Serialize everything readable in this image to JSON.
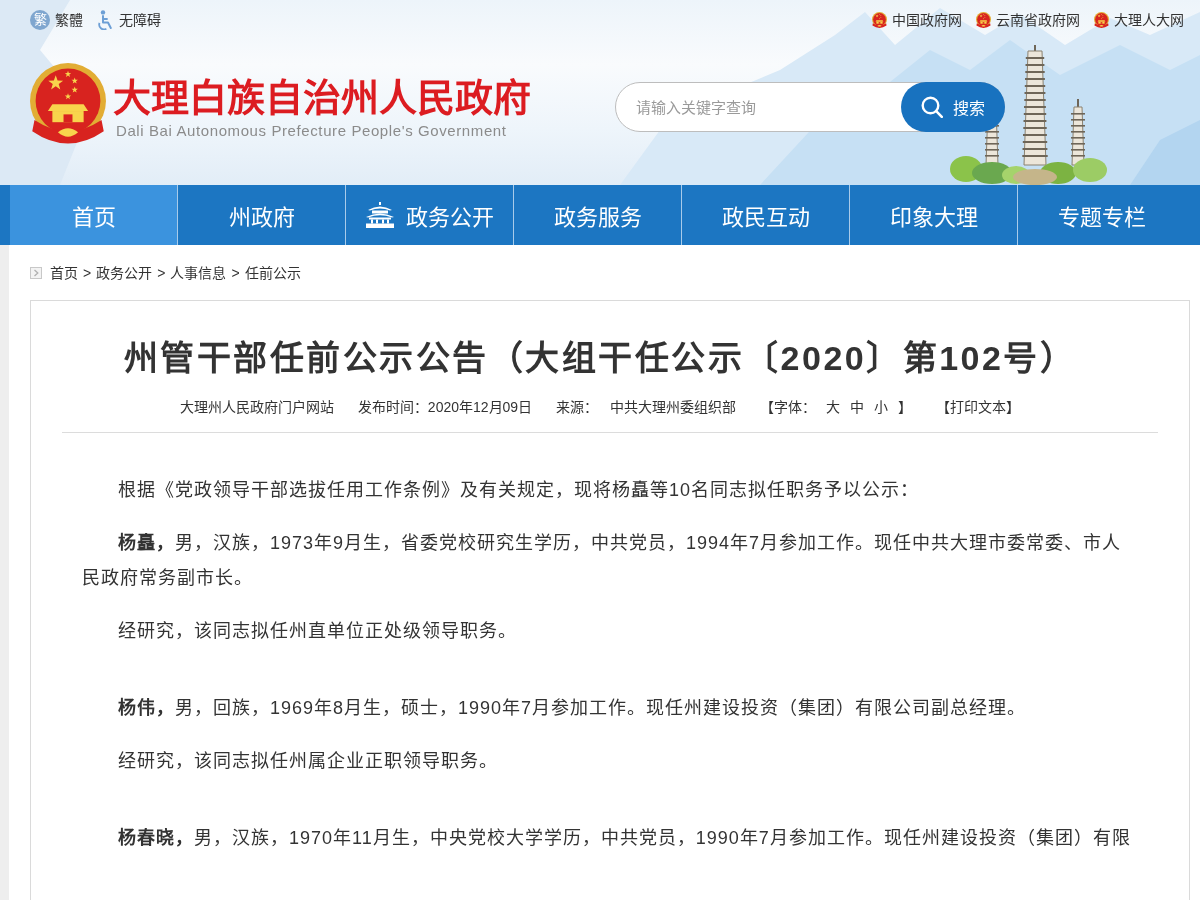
{
  "top_bar": {
    "left_links": [
      {
        "kind": "traditional",
        "icon_text": "繁",
        "label": "繁體"
      },
      {
        "kind": "accessibility",
        "label": "无障碍"
      }
    ],
    "right_links": [
      {
        "label": "中国政府网"
      },
      {
        "label": "云南省政府网"
      },
      {
        "label": "大理人大网"
      }
    ]
  },
  "header": {
    "title": "大理白族自治州人民政府",
    "subtitle": "Dali Bai Autonomous Prefecture People's Government",
    "search": {
      "placeholder": "请输入关键字查询",
      "button": "搜索"
    }
  },
  "nav": [
    {
      "label": "首页",
      "kind": "plain",
      "selected": true
    },
    {
      "label": "州政府",
      "kind": "plain",
      "selected": false
    },
    {
      "label": "政务公开",
      "kind": "with_icon",
      "selected": false
    },
    {
      "label": "政务服务",
      "kind": "plain",
      "selected": false
    },
    {
      "label": "政民互动",
      "kind": "plain",
      "selected": false
    },
    {
      "label": "印象大理",
      "kind": "plain",
      "selected": false
    },
    {
      "label": "专题专栏",
      "kind": "plain",
      "selected": false
    }
  ],
  "breadcrumb": [
    {
      "label": "首页"
    },
    {
      "separator": ">",
      "label": "政务公开"
    },
    {
      "separator": ">",
      "label": "人事信息"
    },
    {
      "separator": ">",
      "label": "任前公示"
    }
  ],
  "article": {
    "title": "州管干部任前公示公告（大组干任公示〔2020〕第102号）",
    "site": "大理州人民政府门户网站",
    "published": "发布时间：2020年12月09日",
    "source_label": "来源：",
    "source": "中共大理州委组织部",
    "font_size": {
      "label": "【字体：",
      "options": [
        "大",
        "中",
        "小"
      ],
      "close": "】"
    },
    "print": "【打印文本】",
    "intro": "根据《党政领导干部选拔任用工作条例》及有关规定，现将杨矗等10名同志拟任职务予以公示：",
    "persons": [
      {
        "bio": "**杨矗，**男，汉族，1973年9月生，省委党校研究生学历，中共党员，1994年7月参加工作。现任中共大理市委常委、市人民政府常务副市长。",
        "conclusion": "经研究，该同志拟任州直单位正处级领导职务。"
      },
      {
        "bio": "**杨伟，**男，回族，1969年8月生，硕士，1990年7月参加工作。现任州建设投资（集团）有限公司副总经理。",
        "conclusion": "经研究，该同志拟任州属企业正职领导职务。"
      },
      {
        "bio": "**杨春晓，**男，汉族，1970年11月生，中央党校大学学历，中共党员，1990年7月参加工作。现任州建设投资（集团）有限"
      }
    ]
  }
}
